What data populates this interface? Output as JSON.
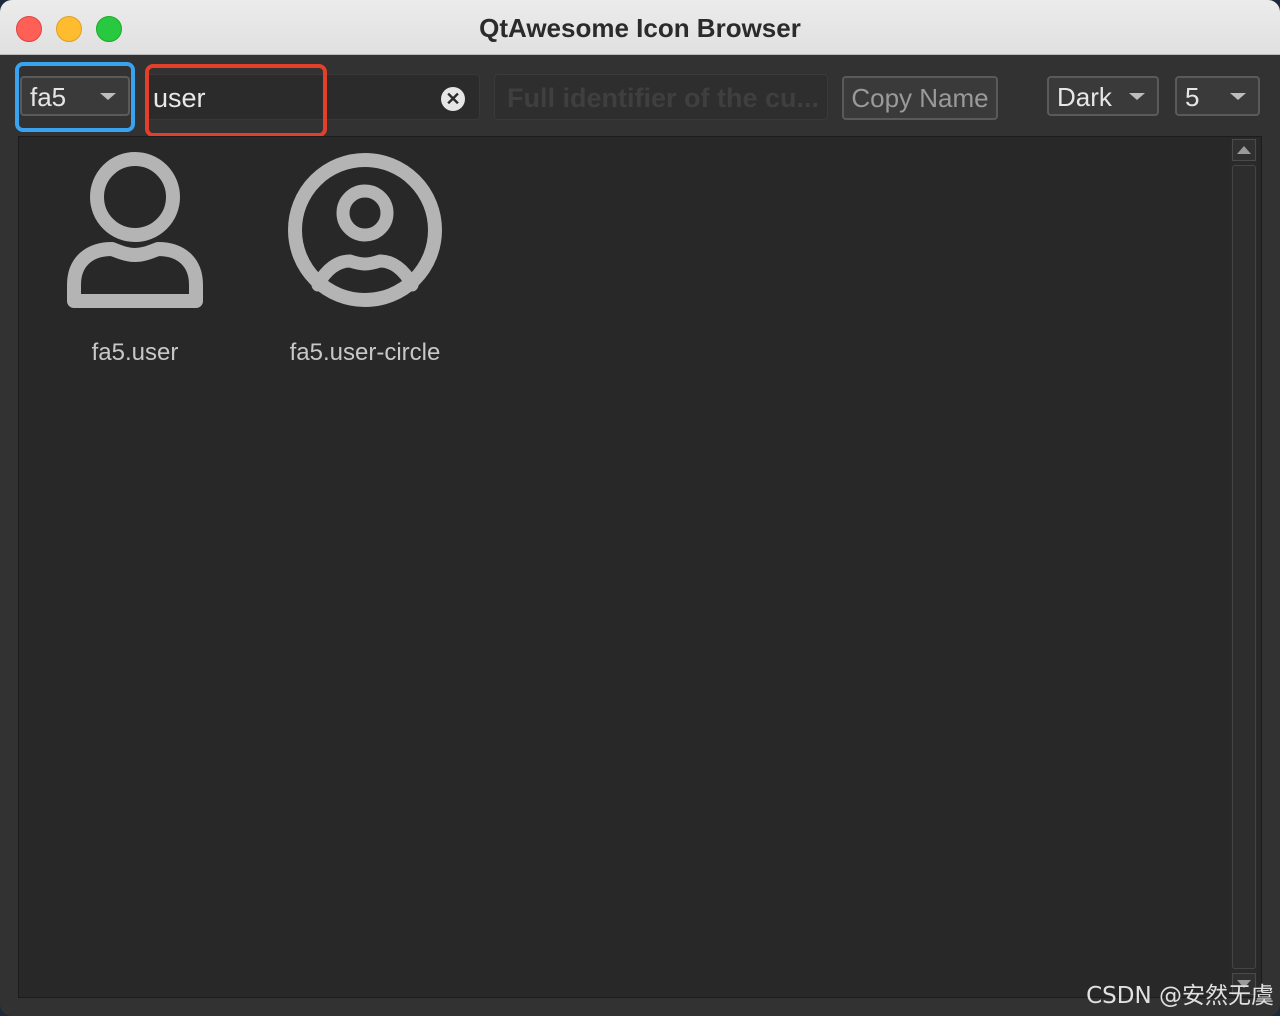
{
  "window": {
    "title": "QtAwesome Icon Browser"
  },
  "toolbar": {
    "font_collection": "fa5",
    "search_value": "user",
    "identifier_placeholder": "Full identifier of the cu...",
    "copy_button_label": "Copy Name",
    "theme": "Dark",
    "columns": "5"
  },
  "icons": [
    {
      "label": "fa5.user",
      "icon": "user-icon"
    },
    {
      "label": "fa5.user-circle",
      "icon": "user-circle-icon"
    }
  ],
  "watermark": "CSDN @安然无虞",
  "colors": {
    "blue_highlight": "#3aa3f0",
    "red_highlight": "#e2402a",
    "icon_gray": "#b4b4b4"
  }
}
